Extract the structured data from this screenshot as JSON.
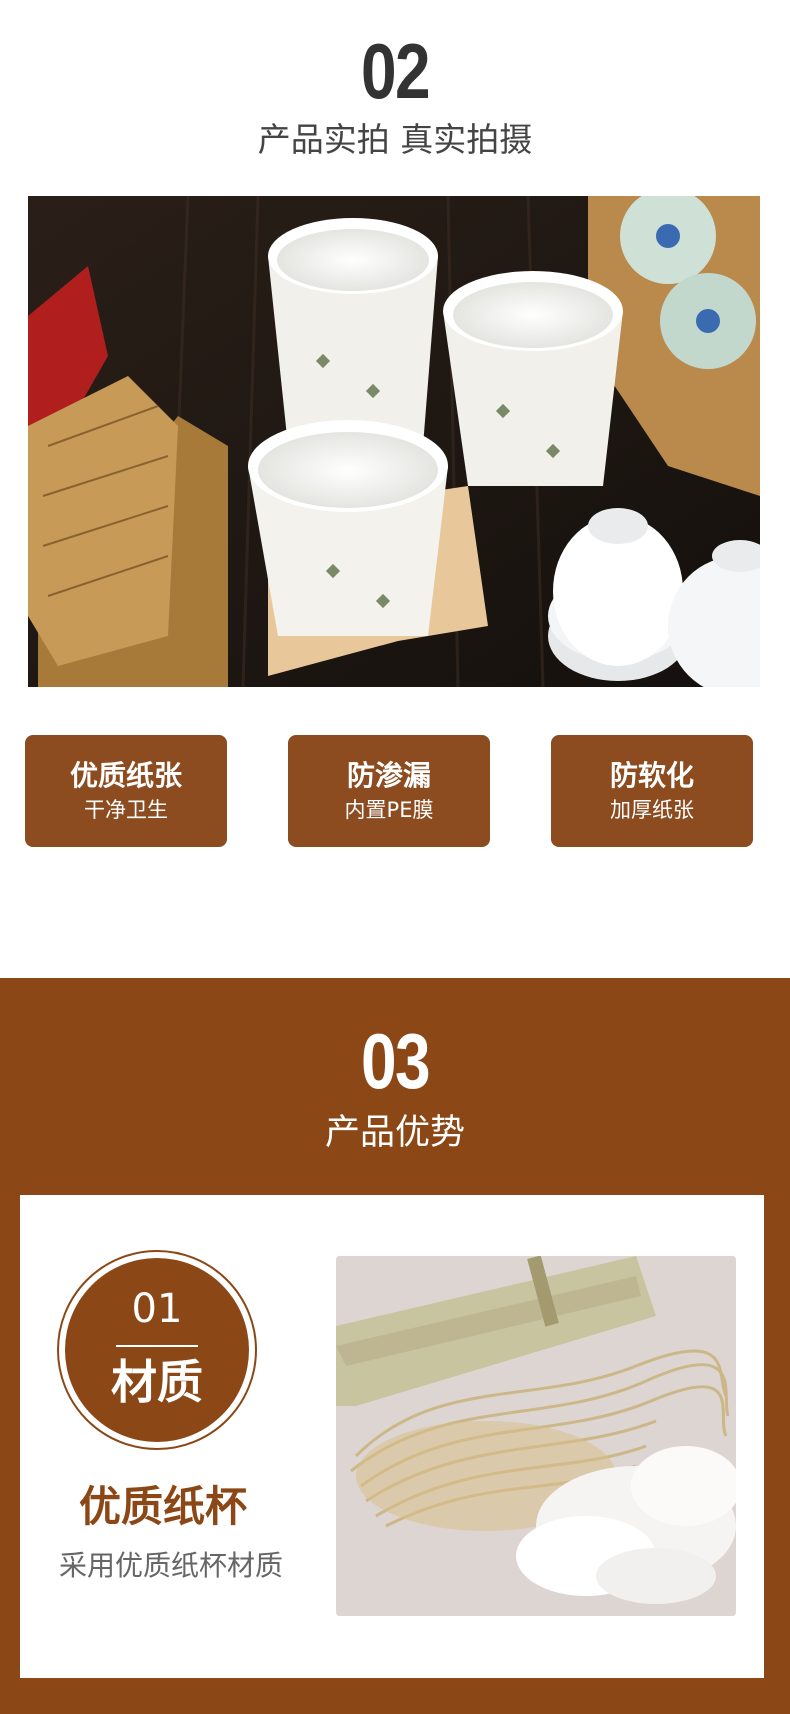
{
  "section02": {
    "number": "02",
    "subtitle": "产品实拍 真实拍摄",
    "features": [
      {
        "title": "优质纸张",
        "subtitle": "干净卫生"
      },
      {
        "title": "防渗漏",
        "subtitle": "内置PE膜"
      },
      {
        "title": "防软化",
        "subtitle": "加厚纸张"
      }
    ]
  },
  "section03": {
    "number": "03",
    "subtitle": "产品优势",
    "item": {
      "number": "01",
      "label": "材质",
      "headline": "优质纸杯",
      "description": "采用优质纸杯材质"
    }
  },
  "colors": {
    "brand_brown": "#8b4816",
    "badge_brown": "#8c4c20",
    "number_dark": "#333333"
  }
}
